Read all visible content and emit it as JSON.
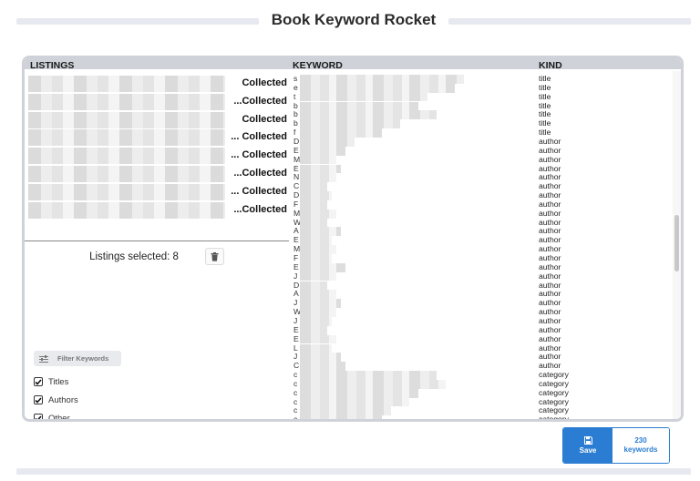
{
  "app": {
    "title": "Book Keyword Rocket"
  },
  "columns": {
    "listings": "LISTINGS",
    "keyword": "KEYWORD",
    "kind": "KIND"
  },
  "listings": {
    "rows": [
      {
        "status": "Collected"
      },
      {
        "status": "...Collected"
      },
      {
        "status": "Collected"
      },
      {
        "status": "... Collected"
      },
      {
        "status": "... Collected"
      },
      {
        "status": "...Collected"
      },
      {
        "status": "... Collected"
      },
      {
        "status": "...Collected"
      }
    ],
    "selected_text": "Listings selected: 8"
  },
  "filter": {
    "button_label": "Filter Keywords",
    "options": [
      {
        "label": "Titles",
        "checked": true
      },
      {
        "label": "Authors",
        "checked": true
      },
      {
        "label": "Other",
        "checked": true
      }
    ]
  },
  "keywords": [
    {
      "keyword": "s",
      "kind": "title"
    },
    {
      "keyword": "e",
      "kind": "title"
    },
    {
      "keyword": "t",
      "kind": "title"
    },
    {
      "keyword": "b",
      "kind": "title"
    },
    {
      "keyword": "b",
      "kind": "title"
    },
    {
      "keyword": "b",
      "kind": "title"
    },
    {
      "keyword": "f",
      "kind": "title"
    },
    {
      "keyword": "D",
      "kind": "author"
    },
    {
      "keyword": "E",
      "kind": "author"
    },
    {
      "keyword": "M",
      "kind": "author"
    },
    {
      "keyword": "E",
      "kind": "author"
    },
    {
      "keyword": "N",
      "kind": "author"
    },
    {
      "keyword": "C",
      "kind": "author"
    },
    {
      "keyword": "D",
      "kind": "author"
    },
    {
      "keyword": "F",
      "kind": "author"
    },
    {
      "keyword": "M",
      "kind": "author"
    },
    {
      "keyword": "W",
      "kind": "author"
    },
    {
      "keyword": "A",
      "kind": "author"
    },
    {
      "keyword": "E",
      "kind": "author"
    },
    {
      "keyword": "M",
      "kind": "author"
    },
    {
      "keyword": "F",
      "kind": "author"
    },
    {
      "keyword": "E",
      "kind": "author"
    },
    {
      "keyword": "J",
      "kind": "author"
    },
    {
      "keyword": "D",
      "kind": "author"
    },
    {
      "keyword": "A",
      "kind": "author"
    },
    {
      "keyword": "J",
      "kind": "author"
    },
    {
      "keyword": "W",
      "kind": "author"
    },
    {
      "keyword": "J",
      "kind": "author"
    },
    {
      "keyword": "E",
      "kind": "author"
    },
    {
      "keyword": "E",
      "kind": "author"
    },
    {
      "keyword": "L",
      "kind": "author"
    },
    {
      "keyword": "J",
      "kind": "author"
    },
    {
      "keyword": "C",
      "kind": "author"
    },
    {
      "keyword": "c",
      "kind": "category"
    },
    {
      "keyword": "c",
      "kind": "category"
    },
    {
      "keyword": "c",
      "kind": "category"
    },
    {
      "keyword": "c",
      "kind": "category"
    },
    {
      "keyword": "c",
      "kind": "category"
    },
    {
      "keyword": "c",
      "kind": "category"
    }
  ],
  "save": {
    "label": "Save",
    "count": "230",
    "count_unit": "keywords"
  },
  "colors": {
    "accent": "#2a7dd2",
    "panel_border": "#cfd3d9"
  }
}
